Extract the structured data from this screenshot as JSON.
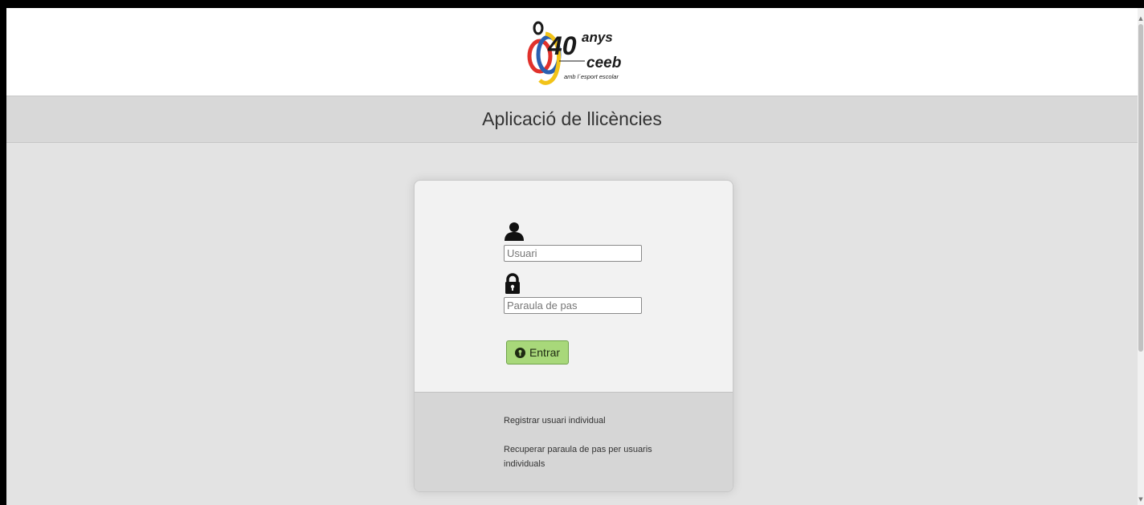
{
  "header": {
    "logo": {
      "text_number": "40",
      "text_anys": "anys",
      "text_org": "ceeb",
      "text_tagline": "amb l´esport escolar",
      "colors": [
        "#1a1a1a",
        "#e0312b",
        "#2a5fb0",
        "#f2c318"
      ]
    }
  },
  "title": "Aplicació de llicències",
  "login": {
    "user_icon": "user-icon",
    "username_placeholder": "Usuari",
    "username_value": "",
    "lock_icon": "lock-icon",
    "password_placeholder": "Paraula de pas",
    "password_value": "",
    "submit_icon": "key-circle-icon",
    "submit_label": "Entrar"
  },
  "links": {
    "register": "Registrar usuari individual",
    "recover": "Recuperar paraula de pas per usuaris individuals"
  },
  "colors": {
    "button_bg": "#a8d87a",
    "header_bg": "#ffffff",
    "title_bar_bg": "#d8d8d8",
    "page_bg": "#e3e3e3"
  }
}
